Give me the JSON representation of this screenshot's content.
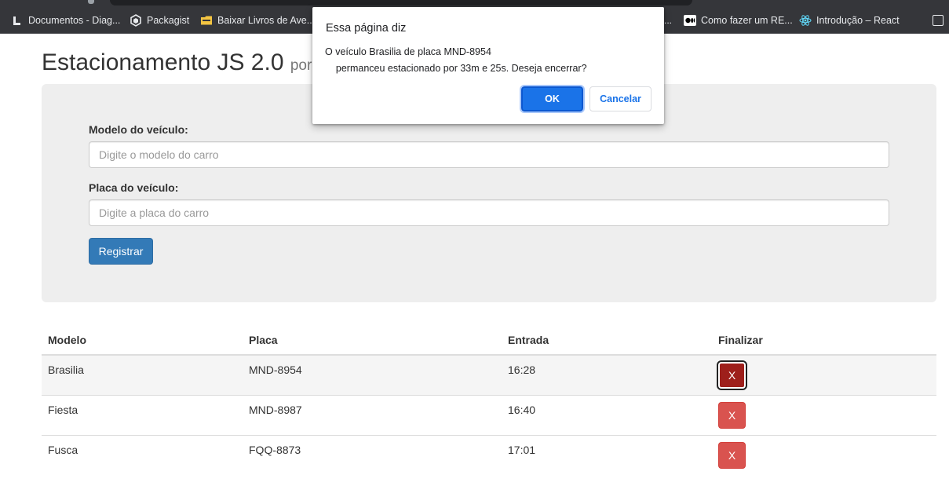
{
  "browser": {
    "bookmarks": [
      {
        "label": "Documentos - Diag...",
        "icon": "docs-bookmark-icon"
      },
      {
        "label": "Packagist",
        "icon": "packagist-icon"
      },
      {
        "label": "Baixar Livros de Ave...",
        "icon": "folder-icon"
      },
      {
        "label": "Como fazer um RE...",
        "icon": "medium-icon"
      },
      {
        "label": "Introdução – React",
        "icon": "react-icon"
      }
    ],
    "more_text": "..."
  },
  "page": {
    "title": "Estacionamento JS 2.0",
    "title_suffix": "por"
  },
  "form": {
    "model_label": "Modelo do veículo:",
    "model_placeholder": "Digite o modelo do carro",
    "plate_label": "Placa do veículo:",
    "plate_placeholder": "Digite a placa do carro",
    "submit_label": "Registrar"
  },
  "table": {
    "headers": [
      "Modelo",
      "Placa",
      "Entrada",
      "Finalizar"
    ],
    "rows": [
      {
        "modelo": "Brasilia",
        "placa": "MND-8954",
        "entrada": "16:28",
        "action": "X"
      },
      {
        "modelo": "Fiesta",
        "placa": "MND-8987",
        "entrada": "16:40",
        "action": "X"
      },
      {
        "modelo": "Fusca",
        "placa": "FQQ-8873",
        "entrada": "17:01",
        "action": "X"
      }
    ]
  },
  "dialog": {
    "title": "Essa página diz",
    "message": "O veículo Brasilia de placa MND-8954\n    permanceu estacionado por 33m e 25s. Deseja encerrar?",
    "ok_label": "OK",
    "cancel_label": "Cancelar"
  },
  "colors": {
    "primary": "#337ab7",
    "danger": "#d9534f",
    "dialog_accent": "#1a73e8",
    "chrome_bar": "#35363a"
  }
}
